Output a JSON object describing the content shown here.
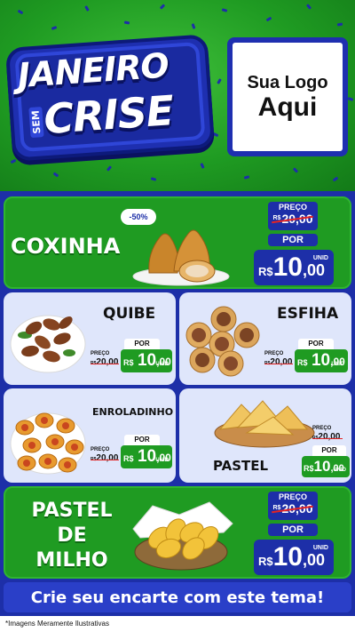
{
  "header": {
    "badge": {
      "line1": "JANEIRO",
      "sem": "SEM",
      "line2": "CRISE"
    },
    "logo": {
      "line1": "Sua Logo",
      "line2": "Aqui"
    }
  },
  "colors": {
    "green": "#1f9b22",
    "blue": "#1d2fa8",
    "light": "#dfe6fb",
    "strike": "#e32424"
  },
  "labels": {
    "preco": "PREÇO",
    "por": "POR",
    "unid": "UNID",
    "currency": "R$"
  },
  "products": {
    "coxinha": {
      "name": "COXINHA",
      "discount": "-50%",
      "old_price": "20,00",
      "new_int": "10",
      "new_dec": ",00"
    },
    "quibe": {
      "name": "QUIBE",
      "old_price": "20,00",
      "new_int": "10",
      "new_dec": ",00"
    },
    "esfiha": {
      "name": "ESFIHA",
      "old_price": "20,00",
      "new_int": "10",
      "new_dec": ",00"
    },
    "enroladinho": {
      "name": "ENROLADINHO",
      "old_price": "20,00",
      "new_int": "10",
      "new_dec": ",00"
    },
    "pastel": {
      "name": "PASTEL",
      "old_price": "20,00",
      "new_int": "10",
      "new_dec": ",00"
    },
    "pastel_milho": {
      "line1": "PASTEL",
      "line2": "DE",
      "line3": "MILHO",
      "old_price": "20,00",
      "new_int": "10",
      "new_dec": ",00"
    }
  },
  "cta": "Crie seu encarte com este tema!",
  "footer": "*Imagens Meramente Ilustrativas"
}
